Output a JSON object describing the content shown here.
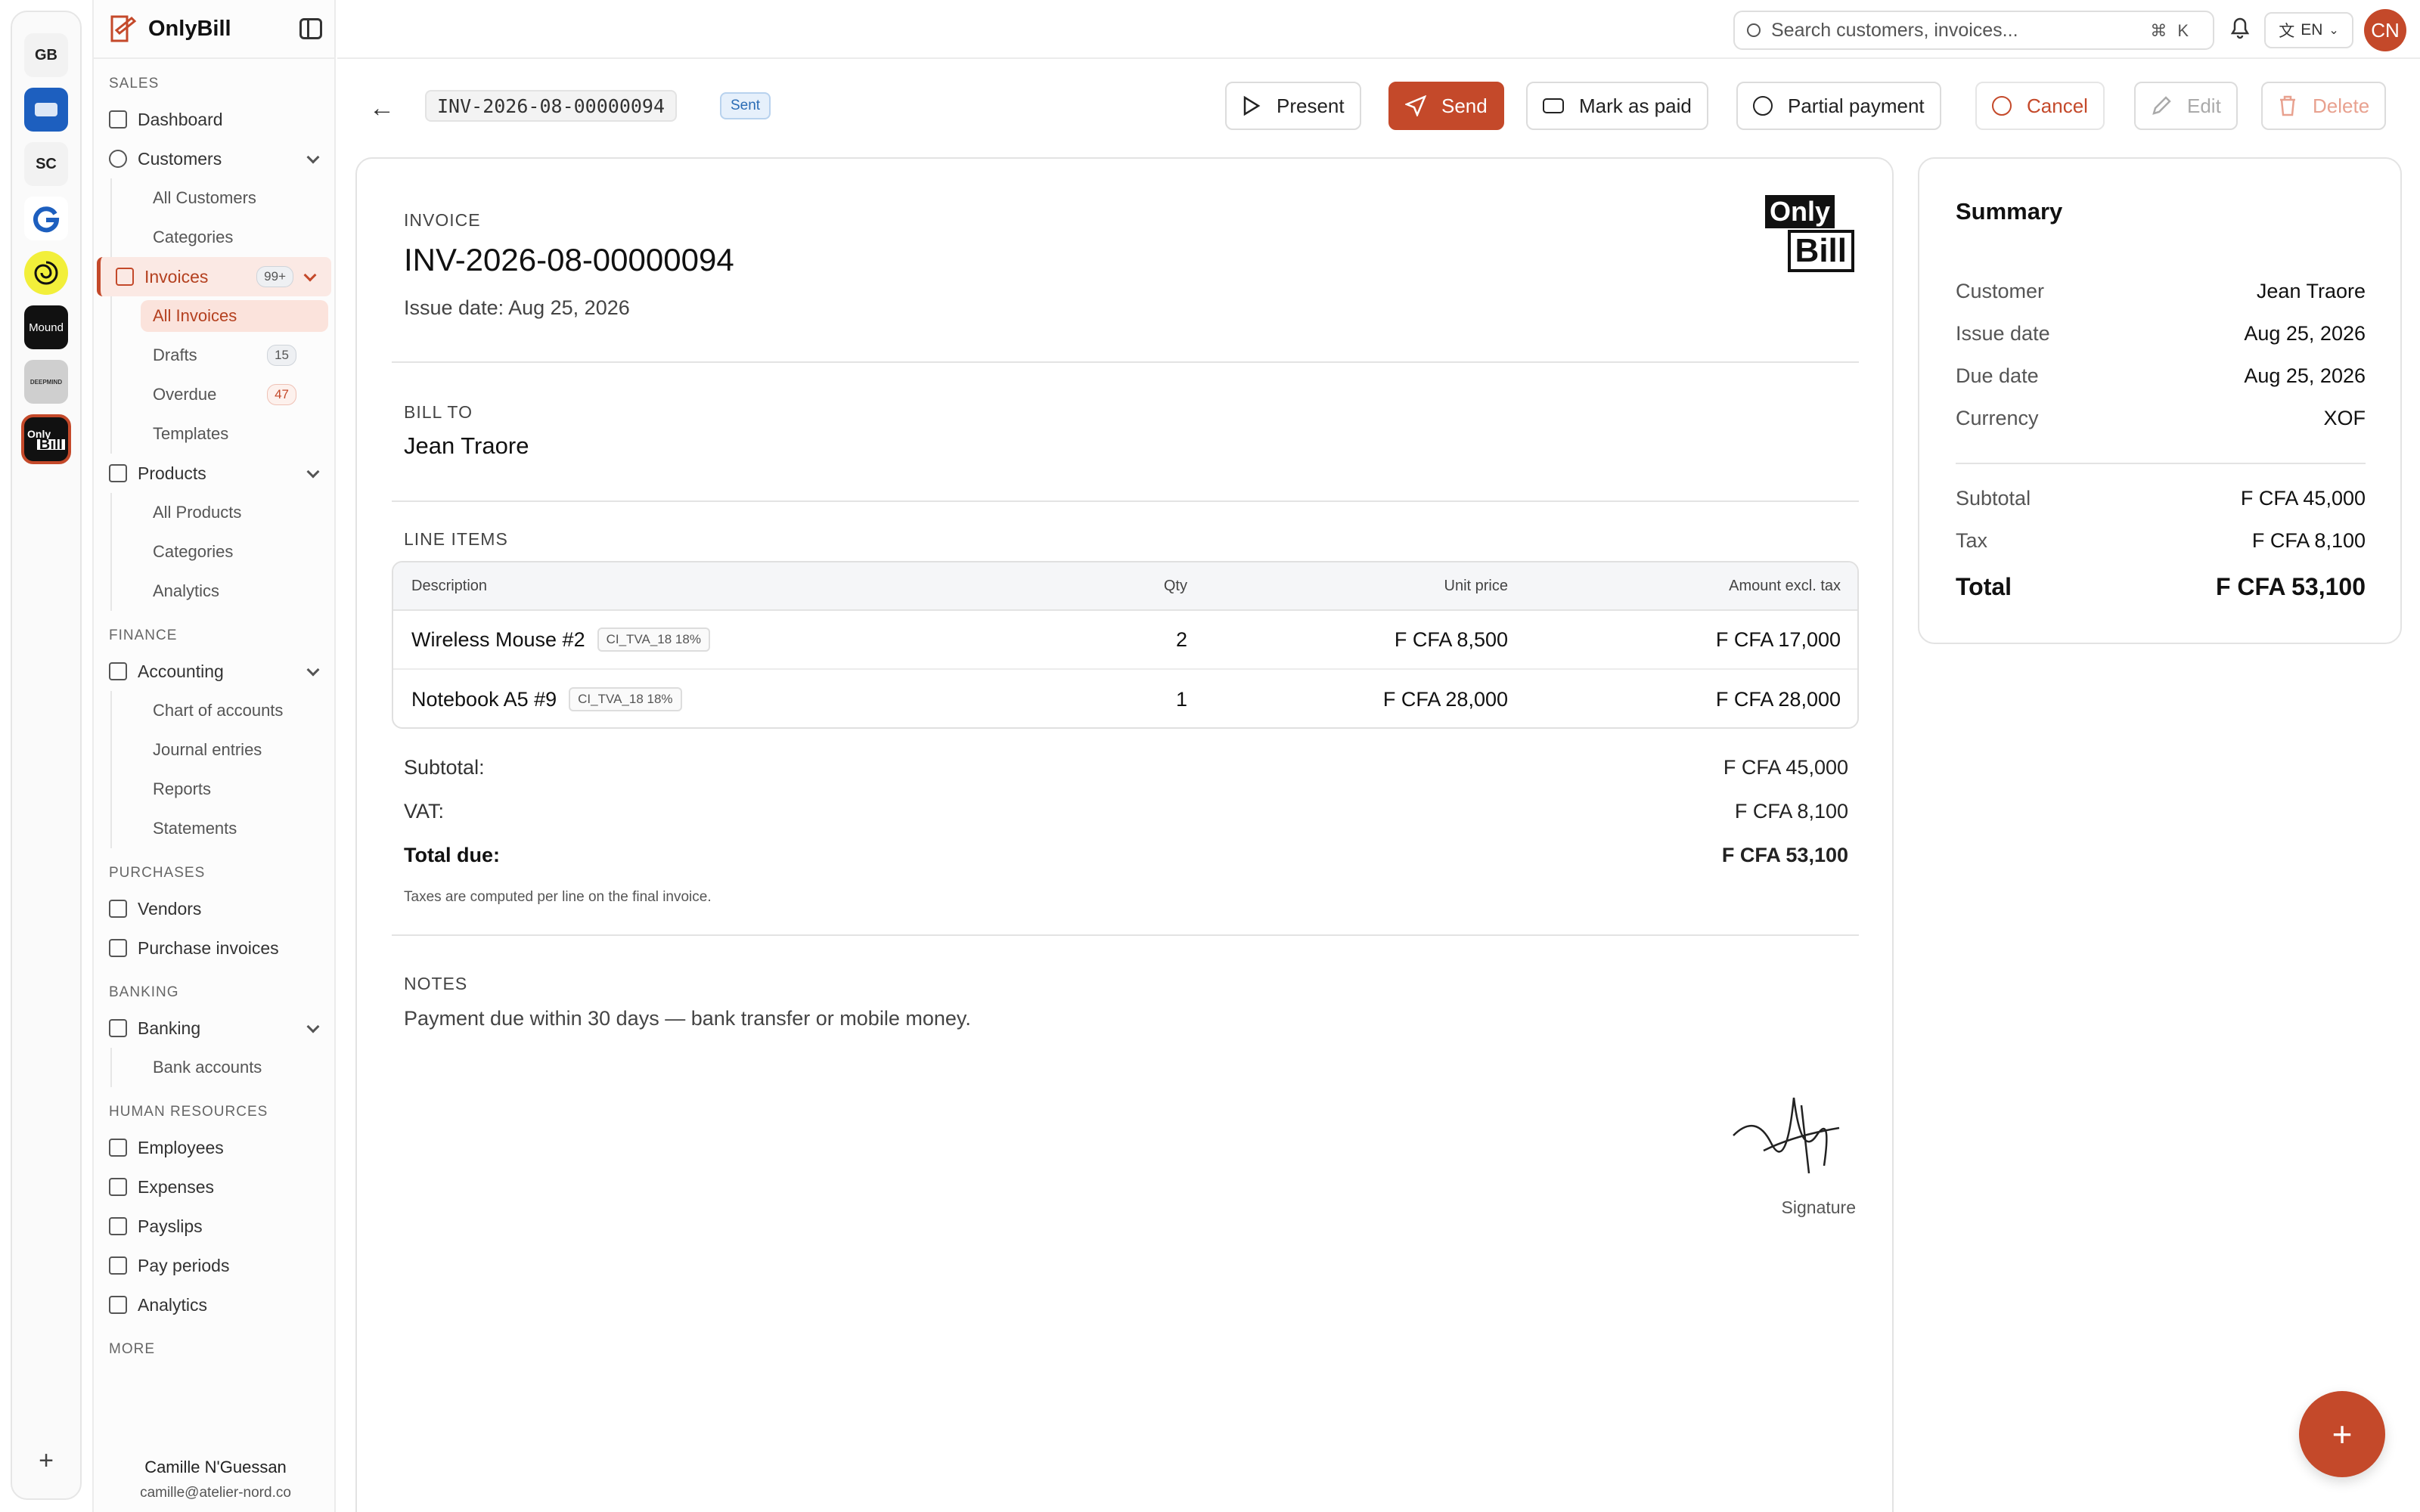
{
  "rail": {
    "workspaces": [
      "GB",
      "SC",
      "Mound",
      "DEEPMIND",
      "Only",
      "Bill"
    ],
    "add": "+"
  },
  "brand": {
    "name": "OnlyBill"
  },
  "sidebar": {
    "sections": {
      "sales": "SALES",
      "finance": "FINANCE",
      "purchases": "PURCHASES",
      "banking": "BANKING",
      "hr": "HUMAN RESOURCES",
      "more": "MORE"
    },
    "dashboard": "Dashboard",
    "customers": "Customers",
    "all_customers": "All Customers",
    "categories": "Categories",
    "invoices": "Invoices",
    "invoices_badge": "99+",
    "all_invoices": "All Invoices",
    "drafts": "Drafts",
    "drafts_badge": "15",
    "overdue": "Overdue",
    "overdue_badge": "47",
    "templates": "Templates",
    "products": "Products",
    "all_products": "All Products",
    "product_categories": "Categories",
    "analytics": "Analytics",
    "accounting": "Accounting",
    "chart_of_accounts": "Chart of accounts",
    "journal_entries": "Journal entries",
    "reports": "Reports",
    "statements": "Statements",
    "vendors": "Vendors",
    "purchase_invoices": "Purchase invoices",
    "banking": "Banking",
    "bank_accounts": "Bank accounts",
    "employees": "Employees",
    "expenses": "Expenses",
    "payslips": "Payslips",
    "pay_periods": "Pay periods",
    "hr_analytics": "Analytics",
    "user_name": "Camille N'Guessan",
    "user_email": "camille@atelier-nord.co"
  },
  "topbar": {
    "search_placeholder": "Search customers, invoices...",
    "shortcut": "⌘K",
    "lang": "EN",
    "avatar": "CN"
  },
  "header": {
    "invoice_id": "INV-2026-08-00000094",
    "status": "Sent",
    "buttons": {
      "present": "Present",
      "send": "Send",
      "mark_paid": "Mark as paid",
      "partial": "Partial payment",
      "cancel": "Cancel",
      "edit": "Edit",
      "delete": "Delete"
    }
  },
  "invoice": {
    "label": "INVOICE",
    "number": "INV-2026-08-00000094",
    "issue_date": "Issue date: Aug 25, 2026",
    "logo_top": "Only",
    "logo_bottom": "Bill",
    "bill_to_label": "BILL TO",
    "bill_to_name": "Jean Traore",
    "line_items_label": "LINE ITEMS",
    "columns": {
      "description": "Description",
      "qty": "Qty",
      "unit_price": "Unit price",
      "amount": "Amount excl. tax"
    },
    "items": [
      {
        "description": "Wireless Mouse #2",
        "tax": "CI_TVA_18 18%",
        "qty": "2",
        "unit_price": "F CFA 8,500",
        "amount": "F CFA 17,000"
      },
      {
        "description": "Notebook A5 #9",
        "tax": "CI_TVA_18 18%",
        "qty": "1",
        "unit_price": "F CFA 28,000",
        "amount": "F CFA 28,000"
      }
    ],
    "subtotal_label": "Subtotal:",
    "subtotal": "F CFA 45,000",
    "vat_label": "VAT:",
    "vat": "F CFA 8,100",
    "total_label": "Total due:",
    "total": "F CFA 53,100",
    "tax_note": "Taxes are computed per line on the final invoice.",
    "notes_label": "NOTES",
    "notes": "Payment due within 30 days — bank transfer or mobile money.",
    "signature_label": "Signature"
  },
  "summary": {
    "title": "Summary",
    "customer_label": "Customer",
    "customer": "Jean Traore",
    "issue_label": "Issue date",
    "issue": "Aug 25, 2026",
    "due_label": "Due date",
    "due": "Aug 25, 2026",
    "currency_label": "Currency",
    "currency": "XOF",
    "subtotal_label": "Subtotal",
    "subtotal": "F CFA 45,000",
    "tax_label": "Tax",
    "tax": "F CFA 8,100",
    "total_label": "Total",
    "total": "F CFA 53,100"
  },
  "colors": {
    "accent": "#c4492a",
    "status_sent": "#2a6cb5"
  },
  "fab": "+"
}
